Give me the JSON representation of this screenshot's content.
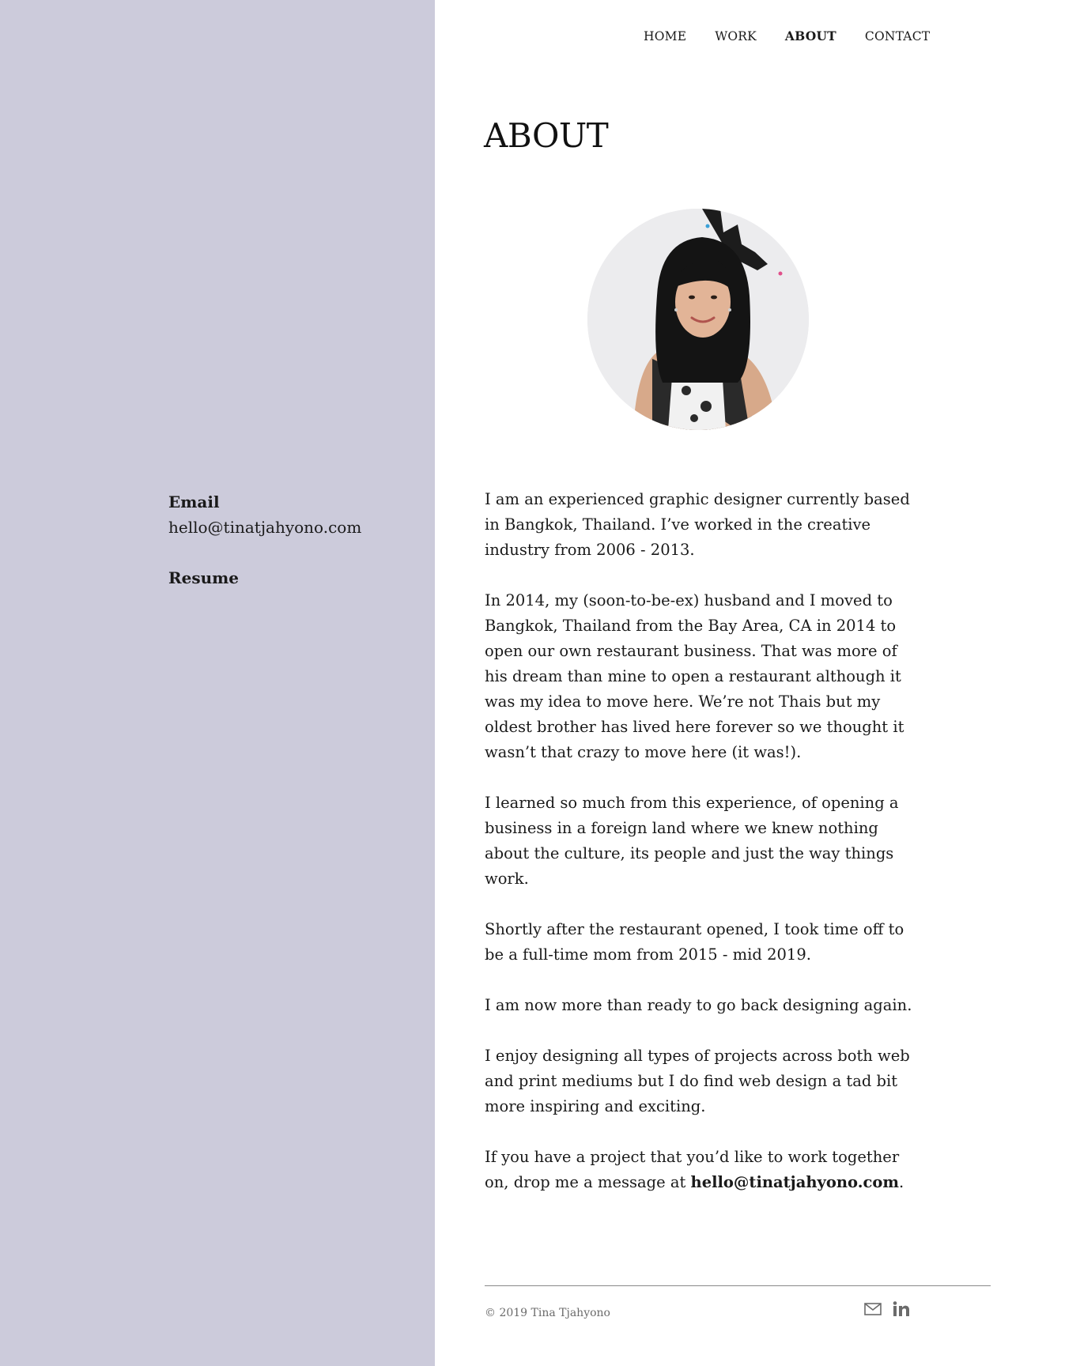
{
  "nav": {
    "items": [
      {
        "label": "HOME",
        "active": false
      },
      {
        "label": "WORK",
        "active": false
      },
      {
        "label": "ABOUT",
        "active": true
      },
      {
        "label": "CONTACT",
        "active": false
      }
    ]
  },
  "sidebar": {
    "email_label": "Email",
    "email_value": "hello@tinatjahyono.com",
    "resume_label": "Resume",
    "background_color": "#cccbdb"
  },
  "main": {
    "title": "ABOUT",
    "avatar_icon": "profile-photo",
    "paragraphs": [
      "I am an experienced graphic designer currently based in Bangkok, Thailand. I’ve worked in the creative industry from 2006 - 2013.",
      "In 2014, my (soon-to-be-ex) husband and I moved to Bangkok, Thailand from the Bay Area, CA in 2014 to open our own restaurant business. That was more of his dream than mine to open a restaurant although it was my idea to move here. We’re not Thais but my oldest brother has lived here forever so we thought it wasn’t that crazy to move here (it was!).",
      "I learned so much from this experience, of opening a business in a foreign land where we knew nothing about the culture, its people and just the way things work.",
      "Shortly after the restaurant opened, I took time off to be a full-time mom from 2015 - mid 2019.",
      "I am now more than ready to go back designing again.",
      "I enjoy designing all types of projects across both web and print mediums but I do find web design a tad bit more inspiring and exciting."
    ],
    "closing_text": "If you have a project that you’d like to work together on, drop me a message at ",
    "closing_email": "hello@tinatjahyono.com",
    "closing_end": "."
  },
  "footer": {
    "copyright": "©  2019  Tina Tjahyono",
    "icons": [
      "mail-icon",
      "linkedin-icon"
    ]
  }
}
